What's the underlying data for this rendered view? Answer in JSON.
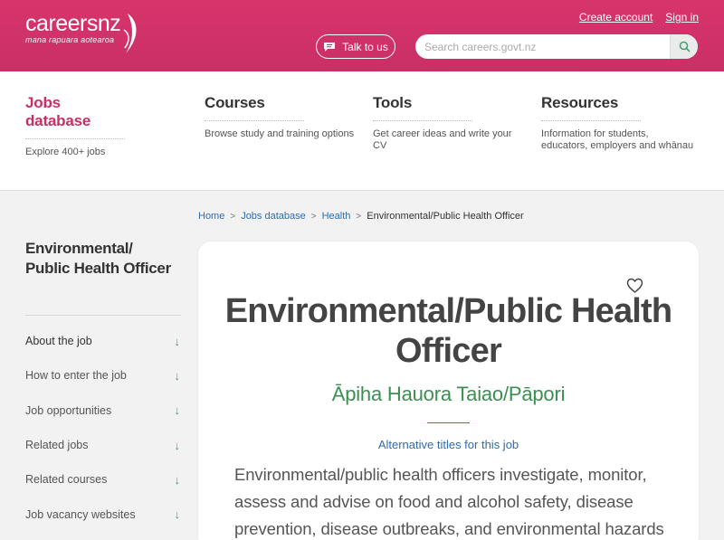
{
  "header": {
    "logo_main": "careersnz",
    "logo_sub": "mana rapuara aotearoa",
    "create_account": "Create account",
    "sign_in": "Sign in",
    "talk_label": "Talk to us",
    "search_placeholder": "Search careers.govt.nz"
  },
  "nav": [
    {
      "title": "Jobs database",
      "desc": "Explore 400+ jobs"
    },
    {
      "title": "Courses",
      "desc": "Browse study and training options"
    },
    {
      "title": "Tools",
      "desc": "Get career ideas and write your CV"
    },
    {
      "title": "Resources",
      "desc": "Information for students, educators, employers and whānau"
    }
  ],
  "breadcrumb": {
    "home": "Home",
    "jobs": "Jobs database",
    "health": "Health",
    "current": "Environmental/Public Health Officer",
    "sep": ">"
  },
  "sidebar": {
    "title": "Environmental/ Public Health Officer",
    "items": [
      {
        "label": "About the job"
      },
      {
        "label": "How to enter the job"
      },
      {
        "label": "Job opportunities"
      },
      {
        "label": "Related jobs"
      },
      {
        "label": "Related courses"
      },
      {
        "label": "Job vacancy websites"
      }
    ],
    "arrow": "↓"
  },
  "main": {
    "title": "Environmental/Public Health Officer",
    "maori_title": "Āpiha Hauora Taiao/Pāpori",
    "alt_titles": "Alternative titles for this job",
    "intro": "Environmental/public health officers investigate, monitor, assess and advise on food and alcohol safety, disease prevention, disease outbreaks, and environmental hazards"
  },
  "colors": {
    "brand": "#c92f66",
    "link": "#2f6bb0",
    "green": "#3c8f52"
  }
}
